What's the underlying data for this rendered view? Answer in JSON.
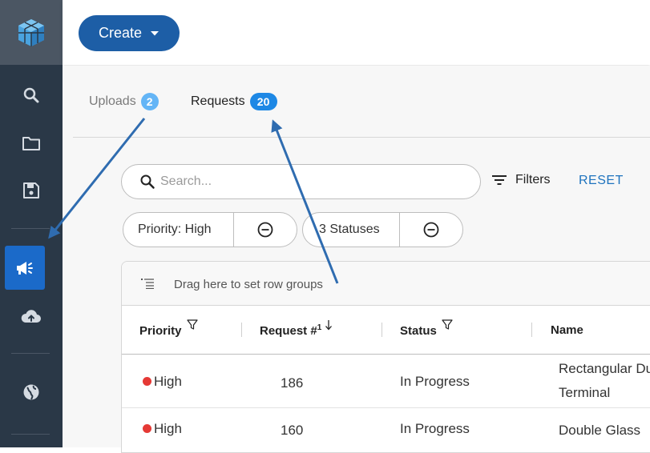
{
  "topbar": {
    "create_label": "Create"
  },
  "sidebar": {
    "items": [
      {
        "icon": "search-icon"
      },
      {
        "icon": "folder-icon"
      },
      {
        "icon": "save-icon"
      },
      {
        "icon": "megaphone-icon",
        "active": true
      },
      {
        "icon": "cloud-upload-icon"
      },
      {
        "icon": "globe-icon"
      }
    ]
  },
  "tabs": [
    {
      "label": "Uploads",
      "count": "2",
      "active": false
    },
    {
      "label": "Requests",
      "count": "20",
      "active": true
    }
  ],
  "search": {
    "placeholder": "Search..."
  },
  "toolbar": {
    "filters_label": "Filters",
    "reset_label": "RESET"
  },
  "chips": [
    {
      "label": "Priority: High"
    },
    {
      "label": "3 Statuses"
    }
  ],
  "grid": {
    "group_hint": "Drag here to set row groups",
    "columns": [
      {
        "label": "Priority"
      },
      {
        "label": "Request #",
        "sort_index": "1"
      },
      {
        "label": "Status"
      },
      {
        "label": "Name"
      }
    ],
    "rows": [
      {
        "priority": "High",
        "request": "186",
        "status": "In Progress",
        "name_line1": "Rectangular Du",
        "name_line2": "Terminal"
      },
      {
        "priority": "High",
        "request": "160",
        "status": "In Progress",
        "name_line1": "Double Glass",
        "name_line2": ""
      }
    ]
  },
  "colors": {
    "sidebar": "#2a3847",
    "accent": "#1d5ea6",
    "active_nav": "#1b6ac9",
    "badge_active": "#1e88e5",
    "badge_inactive": "#64b5f6",
    "priority_high": "#e53935",
    "annotation_arrow": "#2f6cb0"
  }
}
